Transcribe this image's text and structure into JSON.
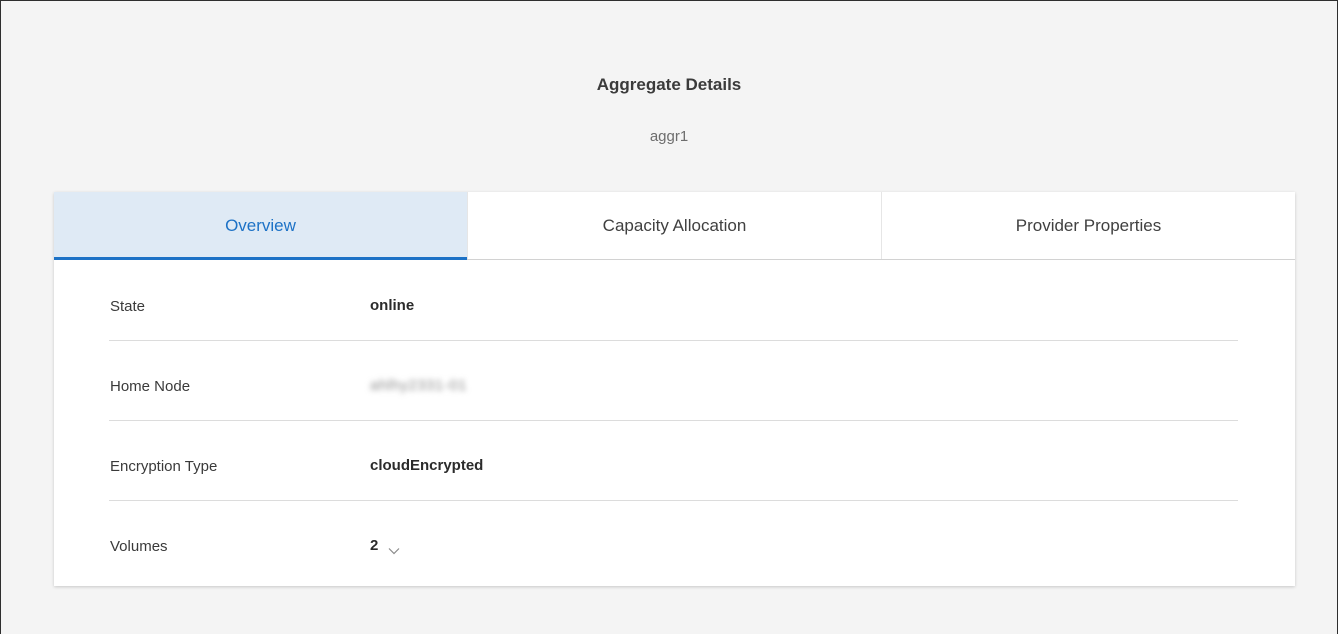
{
  "header": {
    "title": "Aggregate Details",
    "subtitle": "aggr1"
  },
  "tabs": [
    {
      "label": "Overview",
      "active": true
    },
    {
      "label": "Capacity Allocation",
      "active": false
    },
    {
      "label": "Provider Properties",
      "active": false
    }
  ],
  "details": {
    "state": {
      "label": "State",
      "value": "online"
    },
    "home_node": {
      "label": "Home Node",
      "value": "ahlhy2331-01",
      "blurred": true
    },
    "encryption_type": {
      "label": "Encryption Type",
      "value": "cloudEncrypted"
    },
    "volumes": {
      "label": "Volumes",
      "value": "2",
      "expand_icon": "chevron-down-icon"
    }
  },
  "colors": {
    "accent": "#1d72c6",
    "active_tab_bg": "#dfeaf5",
    "page_bg": "#f4f4f4"
  }
}
